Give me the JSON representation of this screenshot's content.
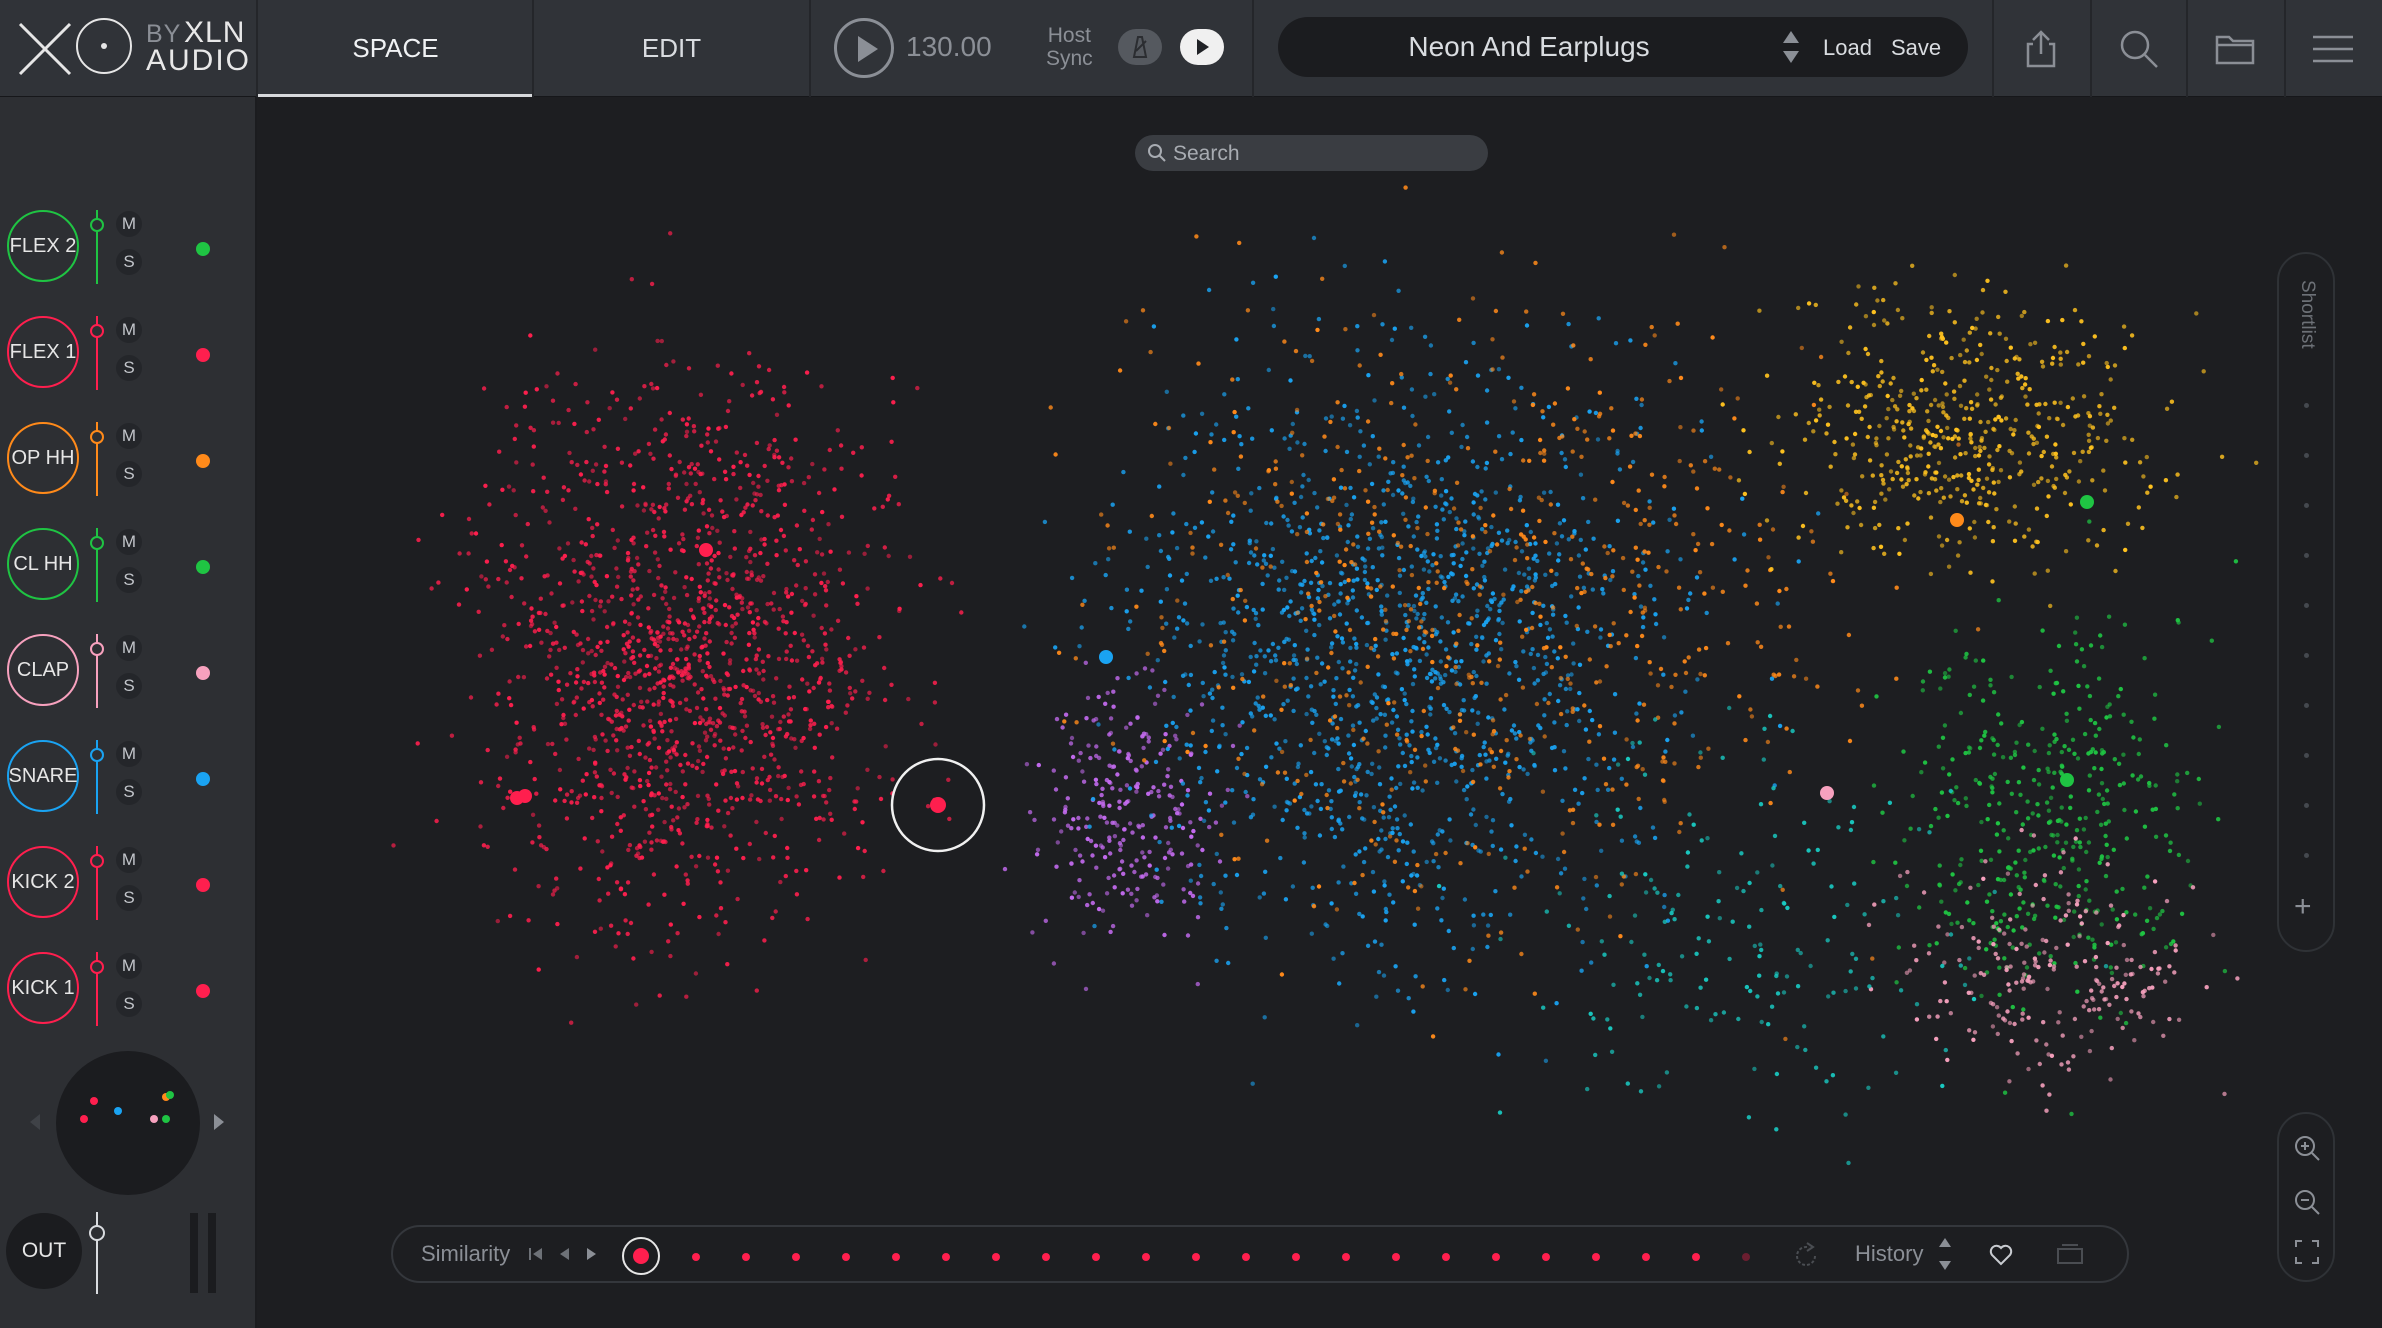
{
  "app": {
    "logo": {
      "by": "BY",
      "xln": "XLN",
      "audio": "AUDIO"
    },
    "tabs": [
      {
        "label": "SPACE",
        "active": true
      },
      {
        "label": "EDIT",
        "active": false
      }
    ]
  },
  "transport": {
    "bpm": "130.00",
    "host_sync_line1": "Host",
    "host_sync_line2": "Sync"
  },
  "preset": {
    "name": "Neon And Earplugs",
    "load": "Load",
    "save": "Save"
  },
  "toolbar_icons": [
    "share-icon",
    "search-icon",
    "folder-icon",
    "menu-icon"
  ],
  "tracks": [
    {
      "label": "FLEX 2",
      "color": "#1fc443"
    },
    {
      "label": "FLEX 1",
      "color": "#ff1f4e"
    },
    {
      "label": "OP HH",
      "color": "#ff8a1a"
    },
    {
      "label": "CL HH",
      "color": "#1fc443"
    },
    {
      "label": "CLAP",
      "color": "#f7a1be"
    },
    {
      "label": "SNARE",
      "color": "#1aa3f2"
    },
    {
      "label": "KICK 2",
      "color": "#ff1f4e"
    },
    {
      "label": "KICK 1",
      "color": "#ff1f4e"
    }
  ],
  "mute_label": "M",
  "solo_label": "S",
  "output": {
    "label": "OUT"
  },
  "search": {
    "placeholder": "Search"
  },
  "shortlist": {
    "label": "Shortlist",
    "add": "+"
  },
  "similarity": {
    "label": "Similarity",
    "history_label": "History",
    "dot_count": 22
  },
  "colors": {
    "red": "#ff1f4e",
    "blue": "#1aa3f2",
    "orange": "#ff8a1a",
    "yellow": "#ffc21f",
    "green": "#1fc443",
    "pink": "#f7a1be",
    "purple": "#c46bf0",
    "teal": "#19c9c1"
  },
  "map": {
    "selected_sample_color": "#ff1f4e",
    "cluster_markers": [
      {
        "color": "#ff1f4e"
      },
      {
        "color": "#ff1f4e"
      },
      {
        "color": "#1aa3f2"
      },
      {
        "color": "#ff8a1a"
      },
      {
        "color": "#1fc443"
      },
      {
        "color": "#f7a1be"
      },
      {
        "color": "#1fc443"
      }
    ]
  }
}
